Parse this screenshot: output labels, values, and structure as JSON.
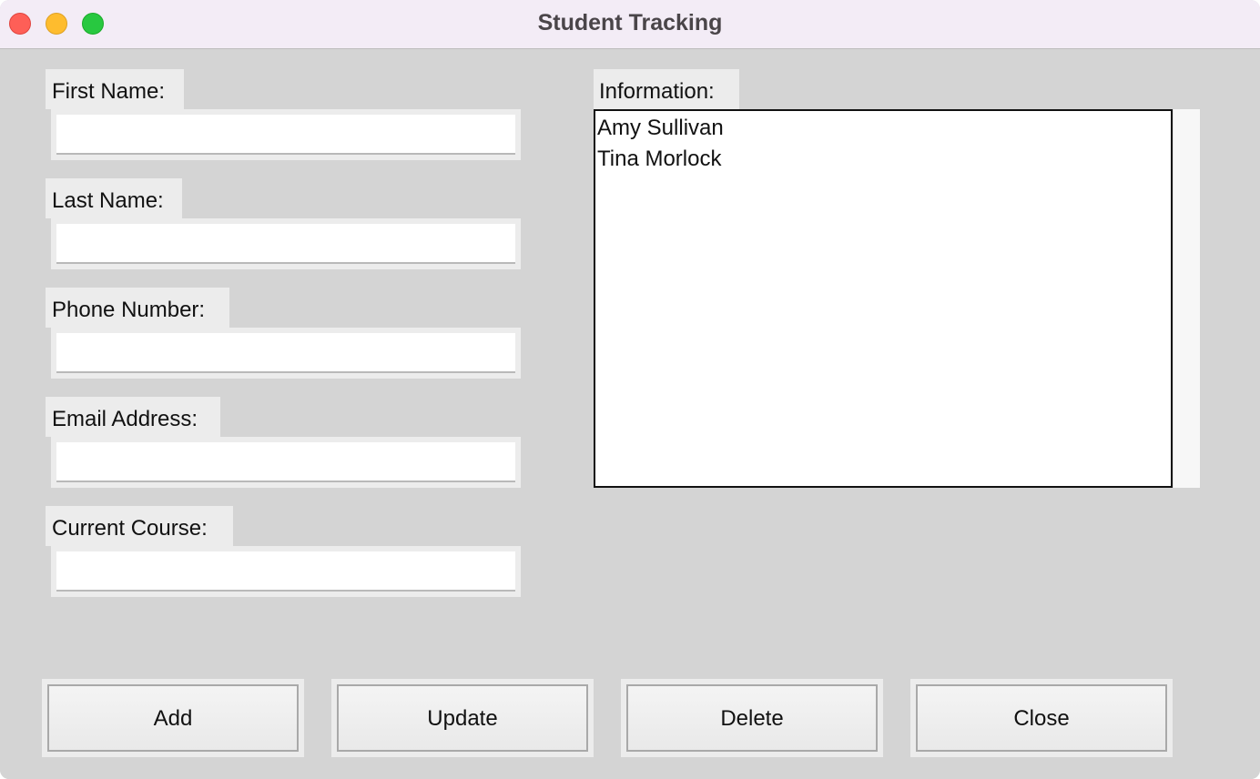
{
  "window": {
    "title": "Student Tracking"
  },
  "form": {
    "fields": [
      {
        "label": "First Name:",
        "value": ""
      },
      {
        "label": "Last Name:",
        "value": ""
      },
      {
        "label": "Phone Number:",
        "value": ""
      },
      {
        "label": "Email Address:",
        "value": ""
      },
      {
        "label": "Current Course:",
        "value": ""
      }
    ]
  },
  "info": {
    "label": "Information:",
    "items": [
      "Amy Sullivan",
      "Tina Morlock"
    ]
  },
  "buttons": {
    "add": "Add",
    "update": "Update",
    "delete": "Delete",
    "close": "Close"
  },
  "colors": {
    "titlebar": "#f3ecf6",
    "background": "#d4d4d4",
    "close_dot": "#fe5f57",
    "minimize_dot": "#febc2e",
    "maximize_dot": "#28c840"
  }
}
